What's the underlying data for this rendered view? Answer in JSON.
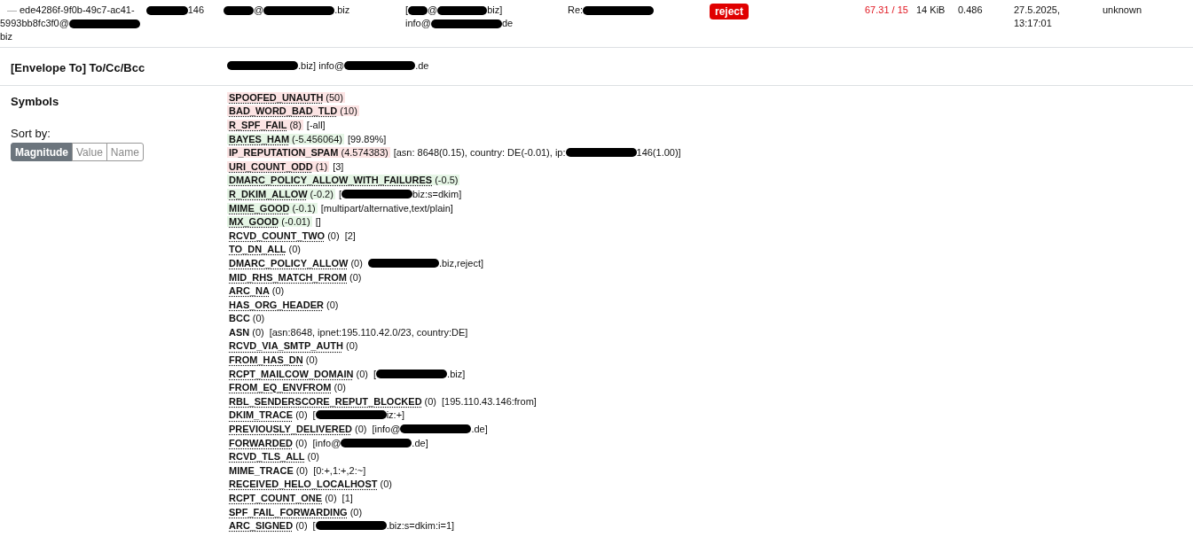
{
  "message": {
    "collapse_icon": "—",
    "id_lines": [
      [
        {
          "kind": "text",
          "text": "ede4286f-9f0b-49c7-ac41-"
        },
        {
          "kind": "gap"
        },
        {
          "kind": "blot-m"
        },
        {
          "kind": "text",
          "text": "146"
        }
      ],
      [
        {
          "kind": "text",
          "text": "5993bb8fc3f0@"
        },
        {
          "kind": "blot-l"
        }
      ],
      [
        {
          "kind": "text",
          "text": "biz"
        }
      ]
    ],
    "from_lines": [
      [
        {
          "kind": "blot-s"
        },
        {
          "kind": "text",
          "text": "@"
        },
        {
          "kind": "blot-l"
        },
        {
          "kind": "text",
          "text": ".biz"
        }
      ]
    ],
    "to_lines": [
      [
        {
          "kind": "text",
          "text": "["
        },
        {
          "kind": "blot-xs"
        },
        {
          "kind": "text",
          "text": "@"
        },
        {
          "kind": "blot-m"
        },
        {
          "kind": "text",
          "text": "biz]"
        }
      ],
      [
        {
          "kind": "text",
          "text": "info@"
        },
        {
          "kind": "blot-l"
        },
        {
          "kind": "text",
          "text": "de"
        }
      ]
    ],
    "subject_lines": [
      [
        {
          "kind": "text",
          "text": "Re:"
        },
        {
          "kind": "blot-l"
        }
      ]
    ],
    "action": "reject",
    "score": "67.31 / 15",
    "over_threshold": true,
    "size": "14 KiB",
    "column_9": "0.486",
    "date_lines": [
      "27.5.2025,",
      "13:17:01"
    ],
    "user": "unknown"
  },
  "envelope": {
    "label": "[Envelope To] To/Cc/Bcc",
    "value": [
      {
        "kind": "blot-l"
      },
      {
        "kind": "text",
        "text": ".biz] info@"
      },
      {
        "kind": "blot-l"
      },
      {
        "kind": "text",
        "text": ".de"
      }
    ]
  },
  "symbols": {
    "label": "Symbols",
    "sort_label": "Sort by:",
    "sort_options": [
      {
        "label": "Magnitude",
        "selected": true
      },
      {
        "label": "Value",
        "selected": false
      },
      {
        "label": "Name",
        "selected": false
      }
    ],
    "items": [
      {
        "name": "SPOOFED_UNAUTH",
        "score": "(50)",
        "color": "#fce4e4",
        "described": true
      },
      {
        "name": "BAD_WORD_BAD_TLD",
        "score": "(10)",
        "color": "#fce4e4",
        "described": true
      },
      {
        "name": "R_SPF_FAIL",
        "score": "(8)",
        "color": "#fce4e4",
        "described": true,
        "options": [
          {
            "kind": "text",
            "text": "[-all]"
          }
        ]
      },
      {
        "name": "BAYES_HAM",
        "score": "(-5.456064)",
        "color": "#e6f6e6",
        "described": true,
        "options": [
          {
            "kind": "text",
            "text": "[99.89%]"
          }
        ]
      },
      {
        "name": "IP_REPUTATION_SPAM",
        "score": "(4.574383)",
        "color": "#fce4e4",
        "described": false,
        "options": [
          {
            "kind": "text",
            "text": "[asn: 8648(0.15), country: DE(-0.01), ip: "
          },
          {
            "kind": "blot-l"
          },
          {
            "kind": "text",
            "text": "146(1.00)]"
          }
        ]
      },
      {
        "name": "URI_COUNT_ODD",
        "score": "(1)",
        "color": "#fce4e4",
        "described": true,
        "options": [
          {
            "kind": "text",
            "text": "[3]"
          }
        ]
      },
      {
        "name": "DMARC_POLICY_ALLOW_WITH_FAILURES",
        "score": "(-0.5)",
        "color": "#e6f6e6",
        "described": true
      },
      {
        "name": "R_DKIM_ALLOW",
        "score": "(-0.2)",
        "color": "#e6f6e6",
        "described": true,
        "options": [
          {
            "kind": "text",
            "text": "["
          },
          {
            "kind": "blot-l"
          },
          {
            "kind": "text",
            "text": "biz:s=dkim]"
          }
        ]
      },
      {
        "name": "MIME_GOOD",
        "score": "(-0.1)",
        "color": "#e6f6e6",
        "described": true,
        "options": [
          {
            "kind": "text",
            "text": "[multipart/alternative,text/plain]"
          }
        ]
      },
      {
        "name": "MX_GOOD",
        "score": "(-0.01)",
        "color": "#e6f6e6",
        "described": true,
        "options": [
          {
            "kind": "text",
            "text": "[]"
          }
        ]
      },
      {
        "name": "RCVD_COUNT_TWO",
        "score": "(0)",
        "described": true,
        "options": [
          {
            "kind": "text",
            "text": "[2]"
          }
        ]
      },
      {
        "name": "TO_DN_ALL",
        "score": "(0)",
        "described": true
      },
      {
        "name": "DMARC_POLICY_ALLOW",
        "score": "(0)",
        "described": true,
        "options": [
          {
            "kind": "blot-l"
          },
          {
            "kind": "text",
            "text": ".biz,reject]"
          }
        ]
      },
      {
        "name": "MID_RHS_MATCH_FROM",
        "score": "(0)",
        "described": true
      },
      {
        "name": "ARC_NA",
        "score": "(0)",
        "described": true
      },
      {
        "name": "HAS_ORG_HEADER",
        "score": "(0)",
        "described": true
      },
      {
        "name": "BCC",
        "score": "(0)",
        "described": false
      },
      {
        "name": "ASN",
        "score": "(0)",
        "described": false,
        "options": [
          {
            "kind": "text",
            "text": "[asn:8648, ipnet:195.110.42.0/23, country:DE]"
          }
        ]
      },
      {
        "name": "RCVD_VIA_SMTP_AUTH",
        "score": "(0)",
        "described": true
      },
      {
        "name": "FROM_HAS_DN",
        "score": "(0)",
        "described": true
      },
      {
        "name": "RCPT_MAILCOW_DOMAIN",
        "score": "(0)",
        "described": true,
        "options": [
          {
            "kind": "text",
            "text": "["
          },
          {
            "kind": "blot-l"
          },
          {
            "kind": "text",
            "text": ".biz]"
          }
        ]
      },
      {
        "name": "FROM_EQ_ENVFROM",
        "score": "(0)",
        "described": true
      },
      {
        "name": "RBL_SENDERSCORE_REPUT_BLOCKED",
        "score": "(0)",
        "described": true,
        "options": [
          {
            "kind": "text",
            "text": "[195.110.43.146:from]"
          }
        ]
      },
      {
        "name": "DKIM_TRACE",
        "score": "(0)",
        "described": true,
        "options": [
          {
            "kind": "text",
            "text": "["
          },
          {
            "kind": "blot-l"
          },
          {
            "kind": "text",
            "text": "iz:+]"
          }
        ]
      },
      {
        "name": "PREVIOUSLY_DELIVERED",
        "score": "(0)",
        "described": true,
        "options": [
          {
            "kind": "text",
            "text": "[info@"
          },
          {
            "kind": "blot-l"
          },
          {
            "kind": "text",
            "text": ".de]"
          }
        ]
      },
      {
        "name": "FORWARDED",
        "score": "(0)",
        "described": true,
        "options": [
          {
            "kind": "text",
            "text": "[info@"
          },
          {
            "kind": "blot-l"
          },
          {
            "kind": "text",
            "text": ".de]"
          }
        ]
      },
      {
        "name": "RCVD_TLS_ALL",
        "score": "(0)",
        "described": true
      },
      {
        "name": "MIME_TRACE",
        "score": "(0)",
        "described": false,
        "options": [
          {
            "kind": "text",
            "text": "[0:+,1:+,2:~]"
          }
        ]
      },
      {
        "name": "RECEIVED_HELO_LOCALHOST",
        "score": "(0)",
        "described": true
      },
      {
        "name": "RCPT_COUNT_ONE",
        "score": "(0)",
        "described": true,
        "options": [
          {
            "kind": "text",
            "text": "[1]"
          }
        ]
      },
      {
        "name": "SPF_FAIL_FORWARDING",
        "score": "(0)",
        "described": true
      },
      {
        "name": "ARC_SIGNED",
        "score": "(0)",
        "described": true,
        "options": [
          {
            "kind": "text",
            "text": "["
          },
          {
            "kind": "blot-l"
          },
          {
            "kind": "text",
            "text": ".biz:s=dkim:i=1]"
          }
        ]
      }
    ]
  }
}
